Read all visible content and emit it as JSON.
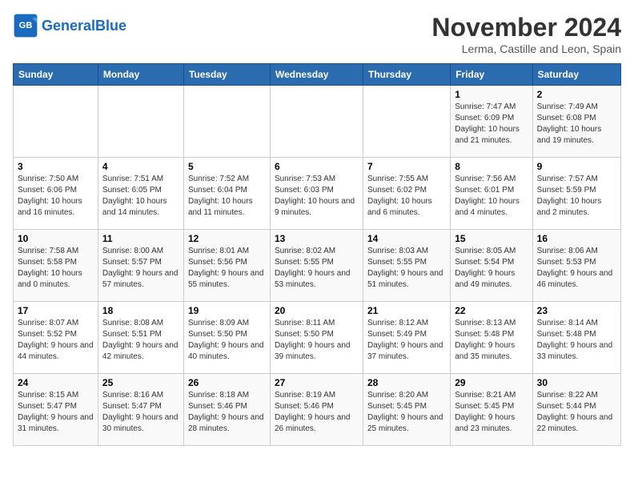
{
  "header": {
    "logo_text_general": "General",
    "logo_text_blue": "Blue",
    "month_title": "November 2024",
    "location": "Lerma, Castille and Leon, Spain"
  },
  "calendar": {
    "weekdays": [
      "Sunday",
      "Monday",
      "Tuesday",
      "Wednesday",
      "Thursday",
      "Friday",
      "Saturday"
    ],
    "weeks": [
      [
        {
          "day": "",
          "info": ""
        },
        {
          "day": "",
          "info": ""
        },
        {
          "day": "",
          "info": ""
        },
        {
          "day": "",
          "info": ""
        },
        {
          "day": "",
          "info": ""
        },
        {
          "day": "1",
          "info": "Sunrise: 7:47 AM\nSunset: 6:09 PM\nDaylight: 10 hours and 21 minutes."
        },
        {
          "day": "2",
          "info": "Sunrise: 7:49 AM\nSunset: 6:08 PM\nDaylight: 10 hours and 19 minutes."
        }
      ],
      [
        {
          "day": "3",
          "info": "Sunrise: 7:50 AM\nSunset: 6:06 PM\nDaylight: 10 hours and 16 minutes."
        },
        {
          "day": "4",
          "info": "Sunrise: 7:51 AM\nSunset: 6:05 PM\nDaylight: 10 hours and 14 minutes."
        },
        {
          "day": "5",
          "info": "Sunrise: 7:52 AM\nSunset: 6:04 PM\nDaylight: 10 hours and 11 minutes."
        },
        {
          "day": "6",
          "info": "Sunrise: 7:53 AM\nSunset: 6:03 PM\nDaylight: 10 hours and 9 minutes."
        },
        {
          "day": "7",
          "info": "Sunrise: 7:55 AM\nSunset: 6:02 PM\nDaylight: 10 hours and 6 minutes."
        },
        {
          "day": "8",
          "info": "Sunrise: 7:56 AM\nSunset: 6:01 PM\nDaylight: 10 hours and 4 minutes."
        },
        {
          "day": "9",
          "info": "Sunrise: 7:57 AM\nSunset: 5:59 PM\nDaylight: 10 hours and 2 minutes."
        }
      ],
      [
        {
          "day": "10",
          "info": "Sunrise: 7:58 AM\nSunset: 5:58 PM\nDaylight: 10 hours and 0 minutes."
        },
        {
          "day": "11",
          "info": "Sunrise: 8:00 AM\nSunset: 5:57 PM\nDaylight: 9 hours and 57 minutes."
        },
        {
          "day": "12",
          "info": "Sunrise: 8:01 AM\nSunset: 5:56 PM\nDaylight: 9 hours and 55 minutes."
        },
        {
          "day": "13",
          "info": "Sunrise: 8:02 AM\nSunset: 5:55 PM\nDaylight: 9 hours and 53 minutes."
        },
        {
          "day": "14",
          "info": "Sunrise: 8:03 AM\nSunset: 5:55 PM\nDaylight: 9 hours and 51 minutes."
        },
        {
          "day": "15",
          "info": "Sunrise: 8:05 AM\nSunset: 5:54 PM\nDaylight: 9 hours and 49 minutes."
        },
        {
          "day": "16",
          "info": "Sunrise: 8:06 AM\nSunset: 5:53 PM\nDaylight: 9 hours and 46 minutes."
        }
      ],
      [
        {
          "day": "17",
          "info": "Sunrise: 8:07 AM\nSunset: 5:52 PM\nDaylight: 9 hours and 44 minutes."
        },
        {
          "day": "18",
          "info": "Sunrise: 8:08 AM\nSunset: 5:51 PM\nDaylight: 9 hours and 42 minutes."
        },
        {
          "day": "19",
          "info": "Sunrise: 8:09 AM\nSunset: 5:50 PM\nDaylight: 9 hours and 40 minutes."
        },
        {
          "day": "20",
          "info": "Sunrise: 8:11 AM\nSunset: 5:50 PM\nDaylight: 9 hours and 39 minutes."
        },
        {
          "day": "21",
          "info": "Sunrise: 8:12 AM\nSunset: 5:49 PM\nDaylight: 9 hours and 37 minutes."
        },
        {
          "day": "22",
          "info": "Sunrise: 8:13 AM\nSunset: 5:48 PM\nDaylight: 9 hours and 35 minutes."
        },
        {
          "day": "23",
          "info": "Sunrise: 8:14 AM\nSunset: 5:48 PM\nDaylight: 9 hours and 33 minutes."
        }
      ],
      [
        {
          "day": "24",
          "info": "Sunrise: 8:15 AM\nSunset: 5:47 PM\nDaylight: 9 hours and 31 minutes."
        },
        {
          "day": "25",
          "info": "Sunrise: 8:16 AM\nSunset: 5:47 PM\nDaylight: 9 hours and 30 minutes."
        },
        {
          "day": "26",
          "info": "Sunrise: 8:18 AM\nSunset: 5:46 PM\nDaylight: 9 hours and 28 minutes."
        },
        {
          "day": "27",
          "info": "Sunrise: 8:19 AM\nSunset: 5:46 PM\nDaylight: 9 hours and 26 minutes."
        },
        {
          "day": "28",
          "info": "Sunrise: 8:20 AM\nSunset: 5:45 PM\nDaylight: 9 hours and 25 minutes."
        },
        {
          "day": "29",
          "info": "Sunrise: 8:21 AM\nSunset: 5:45 PM\nDaylight: 9 hours and 23 minutes."
        },
        {
          "day": "30",
          "info": "Sunrise: 8:22 AM\nSunset: 5:44 PM\nDaylight: 9 hours and 22 minutes."
        }
      ]
    ]
  }
}
